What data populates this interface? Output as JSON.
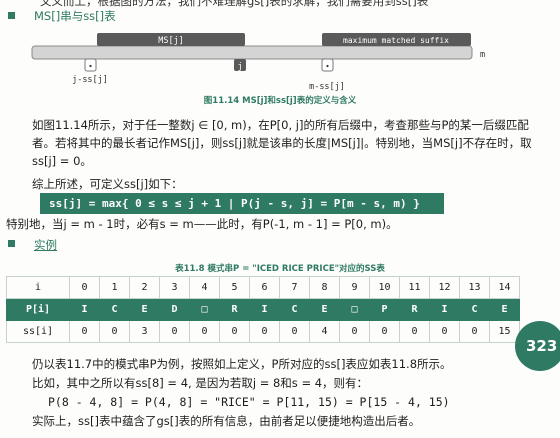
{
  "top_line": "文义而上，根据图的方法，我们不难理解gs[]表的求解，我们需要用到ss[]表",
  "section1": {
    "title": "MS[]串与ss[]表"
  },
  "figure": {
    "ms_label": "MS[j]",
    "suffix_label": "maximum matched suffix",
    "m_label": "m",
    "j_ss_label": "j-ss[j]",
    "j_label": "j",
    "m_ss_label": "m-ss[j]",
    "caption": "图11.14 MS[j]和ss[j]表的定义与含义"
  },
  "paragraphs": {
    "p1": "如图11.14所示，对于任一整数j ∈ [0, m)，在P[0, j]的所有后缀中，考查那些与P的某一后缀匹配者。若将其中的最长者记作MS[j]，则ss[j]就是该串的长度|MS[j]|。特别地，当MS[j]不存在时，取ss[j] = 0。",
    "p2": "综上所述，可定义ss[j]如下：",
    "formula": "ss[j]  =  max{ 0 ≤ s ≤ j + 1  |  P(j - s, j] = P[m - s, m) }",
    "p3": "特别地，当j = m - 1时，必有s = m——此时，有P(-1, m - 1] = P[0, m)。",
    "p4": "仍以表11.7中的模式串P为例，按照如上定义，P所对应的ss[]表应如表11.8所示。",
    "p5": "比如，其中之所以有ss[8] = 4, 是因为若取j = 8和s = 4，则有：",
    "p6": "P(8 - 4, 8]  =  P(4, 8]  =  \"RICE\"  =  P[11, 15)  =  P[15 - 4, 15)",
    "p7": "实际上，ss[]表中蕴含了gs[]表的所有信息，由前者足以便捷地构造出后者。"
  },
  "section2": {
    "title": "实例"
  },
  "table": {
    "caption": "表11.8 模式串P = \"ICED RICE PRICE\"对应的SS表",
    "rows": [
      {
        "head": "i",
        "cells": [
          "0",
          "1",
          "2",
          "3",
          "4",
          "5",
          "6",
          "7",
          "8",
          "9",
          "10",
          "11",
          "12",
          "13",
          "14"
        ],
        "highlight": false
      },
      {
        "head": "P[i]",
        "cells": [
          "I",
          "C",
          "E",
          "D",
          "□",
          "R",
          "I",
          "C",
          "E",
          "□",
          "P",
          "R",
          "I",
          "C",
          "E"
        ],
        "highlight": true
      },
      {
        "head": "ss[i]",
        "cells": [
          "0",
          "0",
          "3",
          "0",
          "0",
          "0",
          "0",
          "0",
          "4",
          "0",
          "0",
          "0",
          "0",
          "0",
          "15"
        ],
        "highlight": false
      }
    ]
  },
  "page_number": "323",
  "colors": {
    "accent": "#2f7a63",
    "bar_dark": "#5a5a5a",
    "bar_light": "#d4d4d4"
  }
}
